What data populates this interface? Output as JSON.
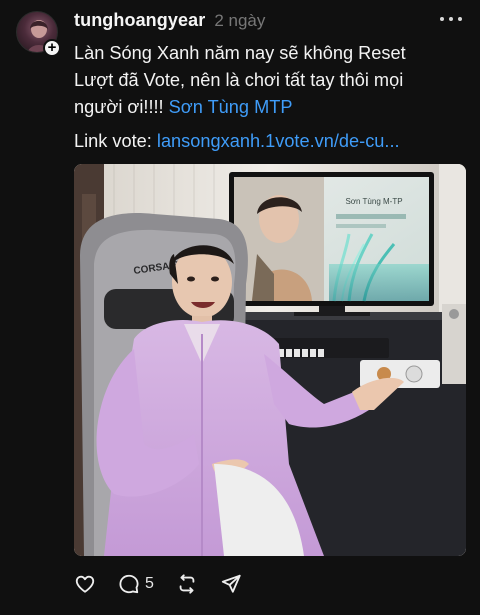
{
  "post": {
    "username": "tunghoangyear",
    "time": "2 ngày",
    "text_lines": [
      "Làn Sóng Xanh năm nay sẽ không Reset",
      "Lượt đã Vote, nên là chơi tất tay thôi mọi",
      "người ơi!!!! "
    ],
    "mention": "Sơn Tùng MTP",
    "vote_label": "Link vote: ",
    "vote_link": "lansongxanh.1vote.vn/de-cu...",
    "media_caption": "Sơn Tùng M-TP",
    "reply_count": "5"
  },
  "icons": {
    "avatar": "avatar",
    "follow": "plus-icon",
    "more": "more-dots-icon",
    "like": "heart-icon",
    "comment": "comment-icon",
    "repost": "repost-icon",
    "share": "send-icon"
  },
  "colors": {
    "background": "#101010",
    "link": "#3f9cf8",
    "muted": "#777777",
    "text": "#f3f3f3"
  }
}
